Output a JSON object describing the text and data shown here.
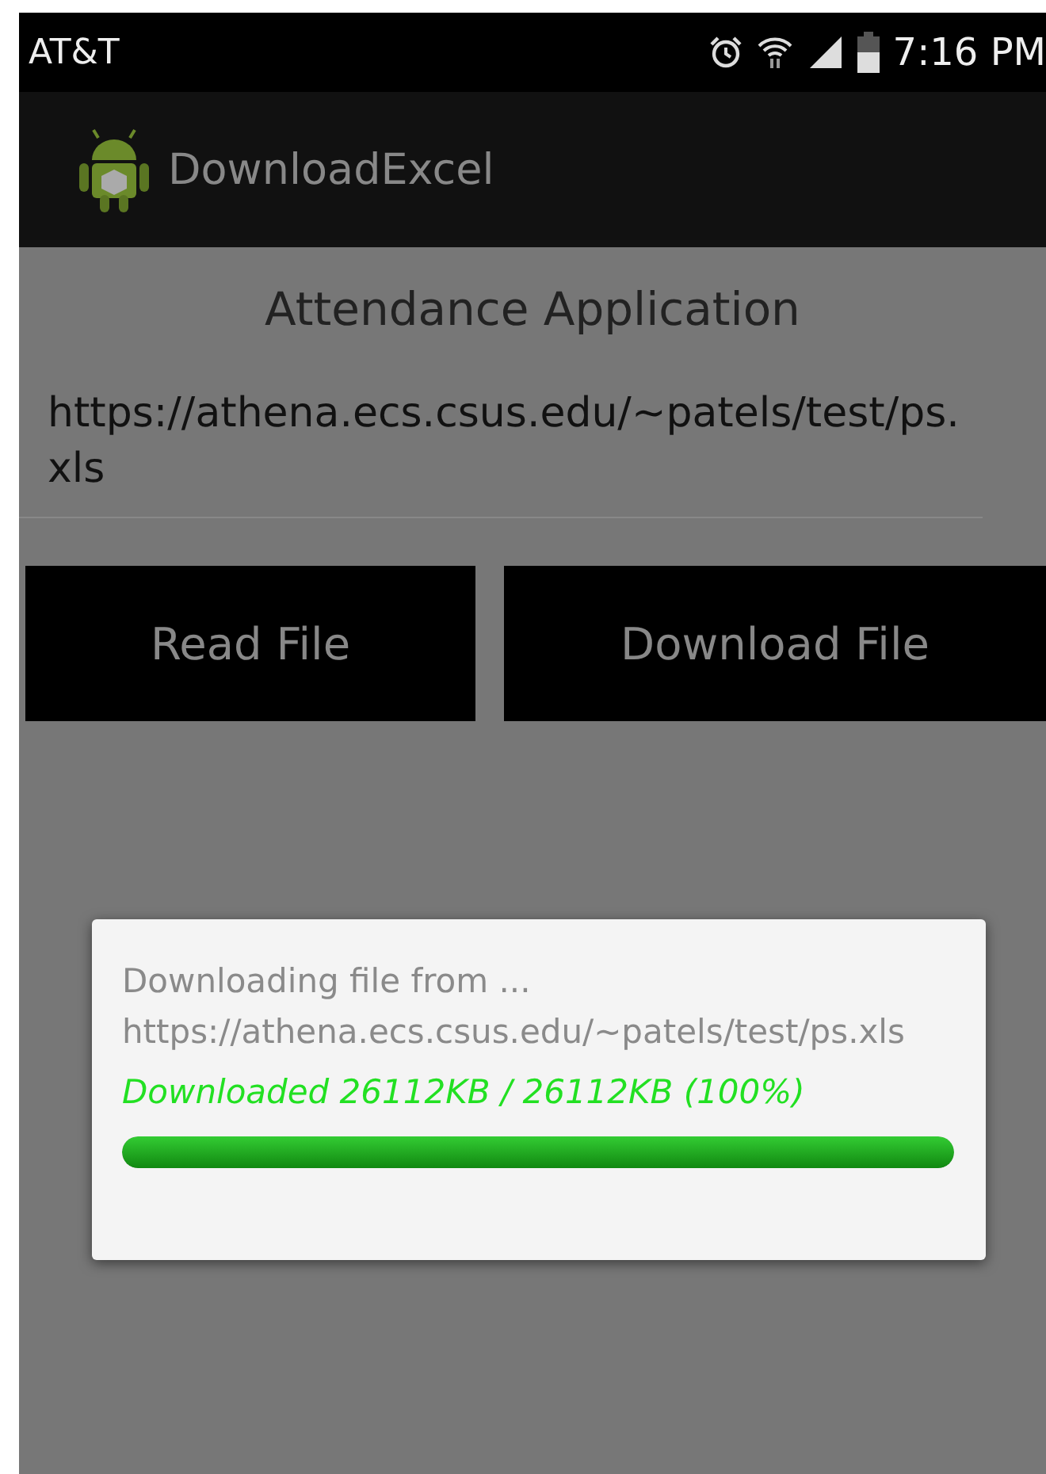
{
  "status_bar": {
    "carrier": "AT&T",
    "time": "7:16 PM"
  },
  "action_bar": {
    "title": "DownloadExcel"
  },
  "heading": "Attendance Application",
  "url": "https://athena.ecs.csus.edu/~patels/test/ps.xls",
  "buttons": [
    "Read File",
    "Download File"
  ],
  "dialog": {
    "message": "Downloading file from ... https://athena.ecs.csus.edu/~patels/test/ps.xls",
    "progress_text": "Downloaded 26112KB / 26112KB (100%)",
    "level": 1
  }
}
